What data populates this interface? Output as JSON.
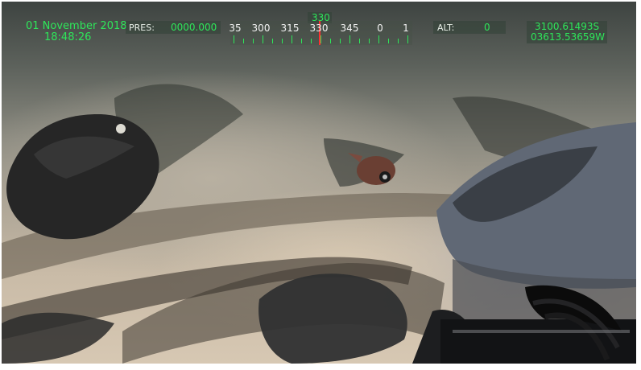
{
  "hud": {
    "date": "01 November 2018",
    "time": "18:48:26",
    "pressure_label": "PRES:",
    "pressure_value": "0000.000",
    "heading_value": "330",
    "compass_numbers": [
      "35",
      "300",
      "315",
      "330",
      "345",
      "0",
      "1"
    ],
    "altitude_label": "ALT:",
    "altitude_value": "0",
    "latitude": "3100.61493S",
    "longitude": "03613.53659W"
  },
  "colors": {
    "hud_text": "#2ee65a",
    "needle": "#ff3030"
  }
}
